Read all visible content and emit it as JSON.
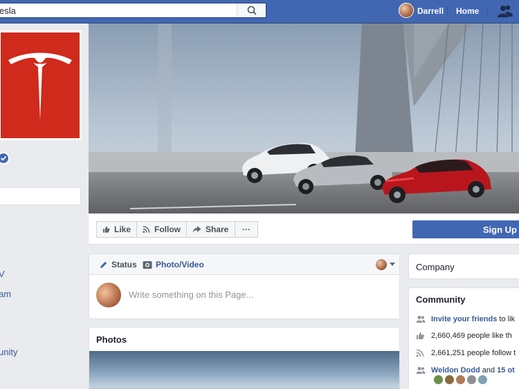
{
  "topbar": {
    "search_value": "esla",
    "user_name": "Darrell",
    "home_label": "Home"
  },
  "left": {
    "frag1": "V",
    "frag2": "am",
    "frag3": "unity"
  },
  "actions": {
    "like": "Like",
    "follow": "Follow",
    "share": "Share",
    "more": "···",
    "signup": "Sign Up"
  },
  "composer": {
    "status_tab": "Status",
    "photo_tab": "Photo/Video",
    "placeholder": "Write something on this Page..."
  },
  "photos": {
    "title": "Photos"
  },
  "right": {
    "company": "Company",
    "community_title": "Community",
    "invite_link": "Invite your friends",
    "invite_rest": "to lik",
    "likes": "2,660,469 people like th",
    "follows": "2,661,251 people follow t",
    "friend_link": "Weldon Dodd",
    "friend_rest": "and",
    "friend_more": "15 ot"
  },
  "colors": {
    "brand_blue": "#4267b2",
    "tesla_red": "#cf2a1c",
    "link_blue": "#365899"
  }
}
